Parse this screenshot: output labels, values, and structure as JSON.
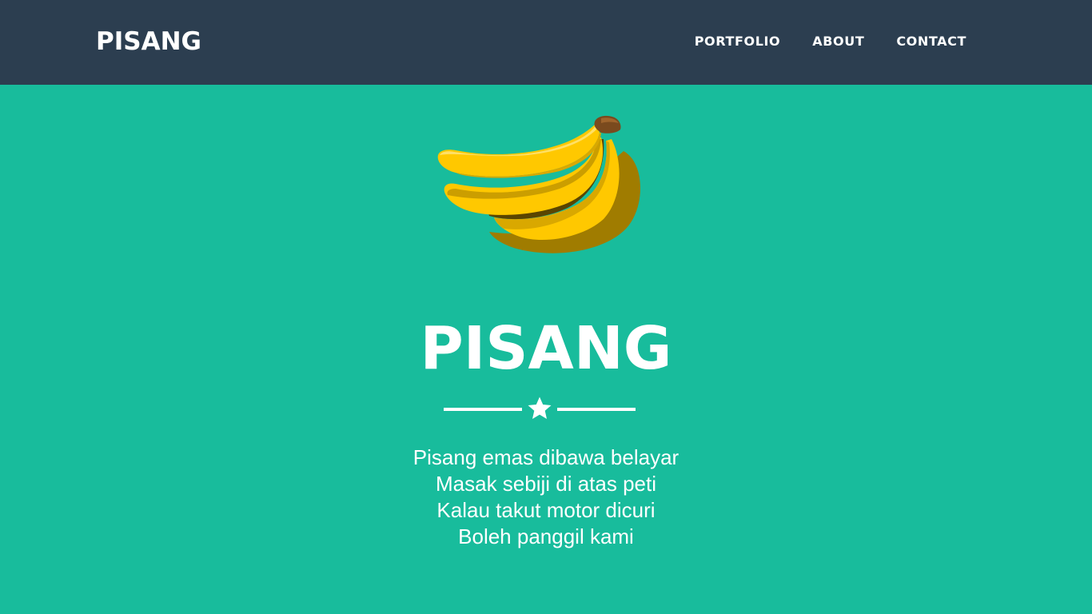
{
  "navbar": {
    "brand": "PISANG",
    "links": [
      {
        "label": "PORTFOLIO"
      },
      {
        "label": "ABOUT"
      },
      {
        "label": "CONTACT"
      }
    ]
  },
  "hero": {
    "image_icon": "banana-bunch-icon",
    "title": "PISANG",
    "divider_icon": "star-icon",
    "lines": [
      "Pisang emas dibawa belayar",
      "Masak sebiji di atas peti",
      "Kalau takut motor dicuri",
      "Boleh panggil kami"
    ]
  },
  "colors": {
    "navbar_bg": "#2c3e50",
    "hero_bg": "#18bc9c",
    "text": "#ffffff",
    "banana_yellow": "#ffc800",
    "banana_shadow": "#a07c00",
    "banana_stem": "#7a4a1e"
  }
}
